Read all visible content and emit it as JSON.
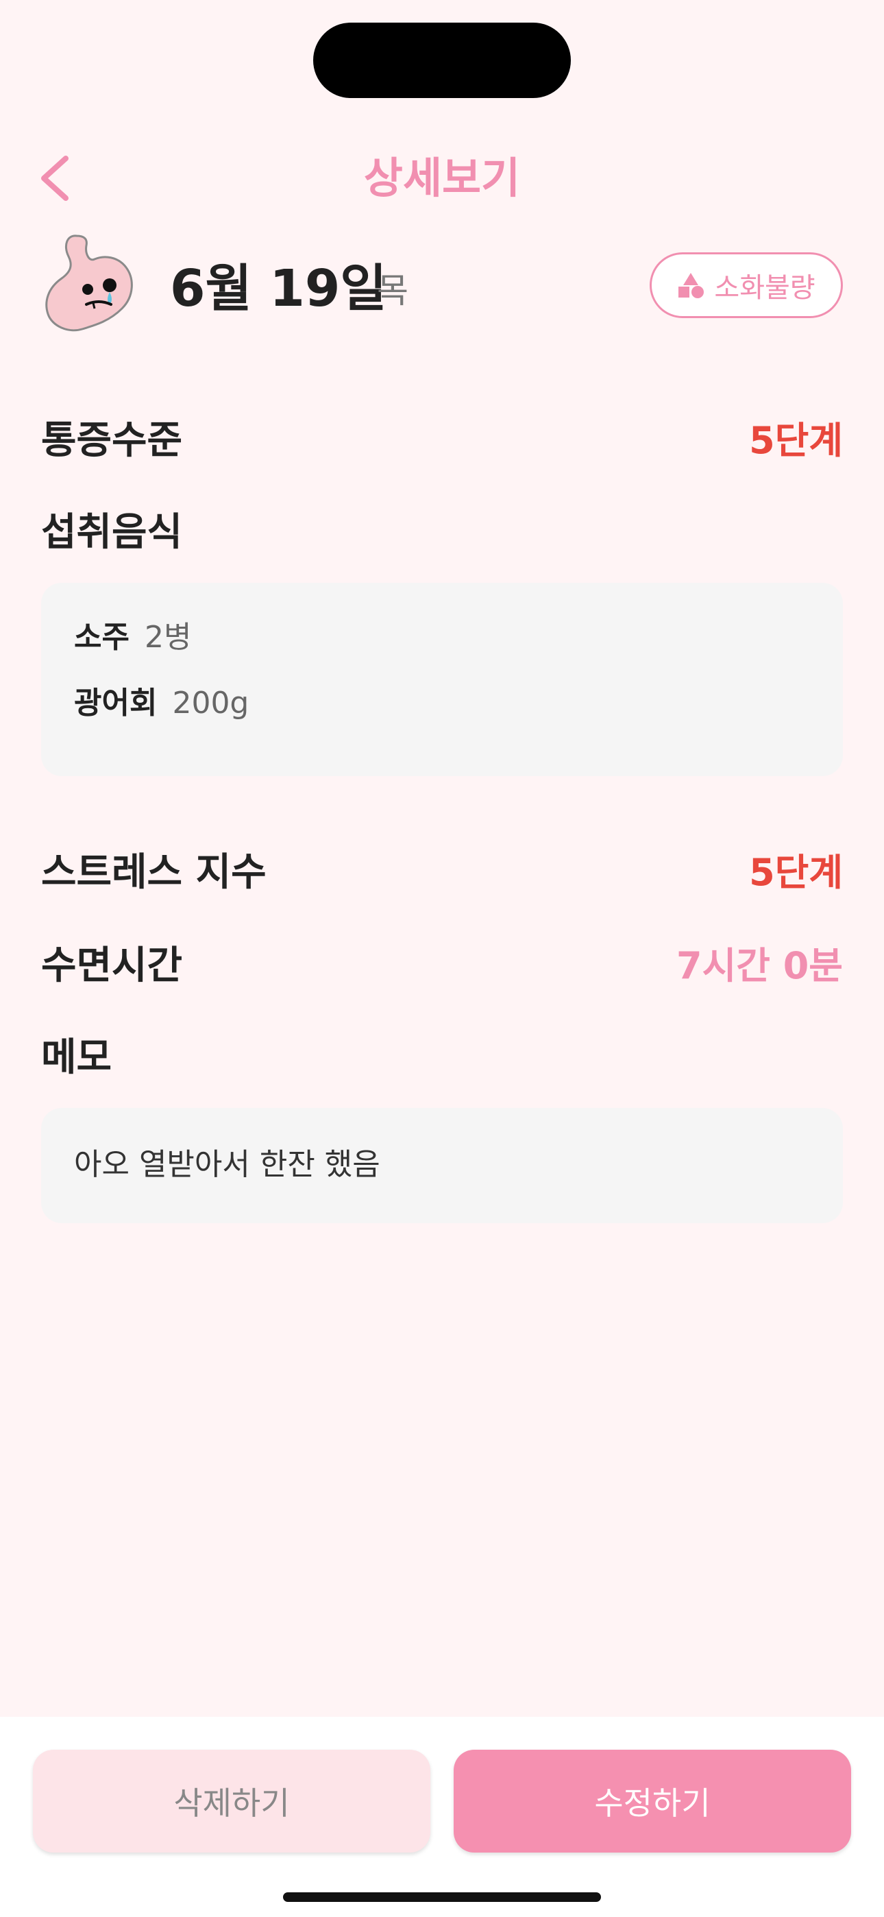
{
  "header": {
    "title": "상세보기"
  },
  "entry": {
    "date": "6월 19일",
    "weekday": "목",
    "symptom_badge": "소화불량"
  },
  "pain_level": {
    "label": "통증수준",
    "value": "5단계"
  },
  "food": {
    "label": "섭취음식",
    "items": [
      {
        "name": "소주",
        "quantity": "2병"
      },
      {
        "name": "광어회",
        "quantity": "200g"
      }
    ]
  },
  "stress": {
    "label": "스트레스 지수",
    "value": "5단계"
  },
  "sleep": {
    "label": "수면시간",
    "value": "7시간 0분"
  },
  "memo": {
    "label": "메모",
    "text": "아오 열받아서 한잔 했음"
  },
  "actions": {
    "delete_label": "삭제하기",
    "edit_label": "수정하기"
  },
  "colors": {
    "accent": "#f18fb0",
    "danger": "#e8473c",
    "background": "#fff4f5"
  }
}
